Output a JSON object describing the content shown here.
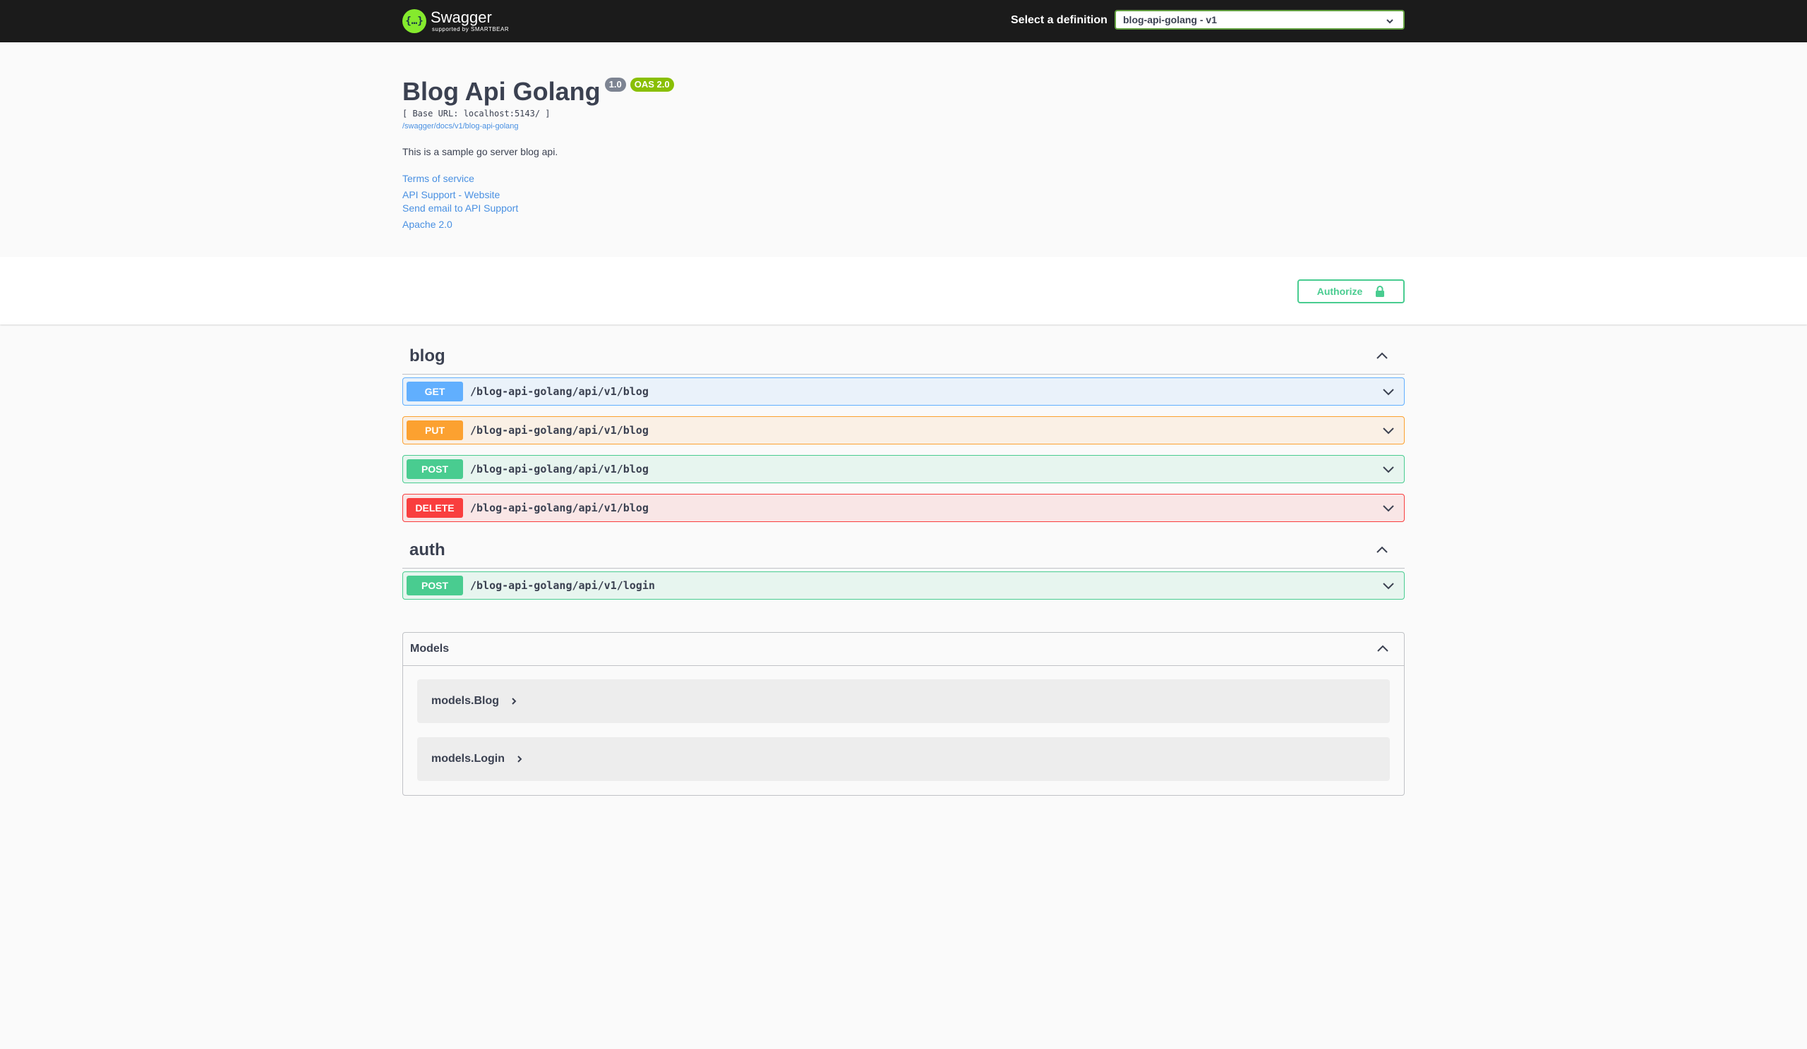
{
  "topbar": {
    "logo_name": "Swagger",
    "logo_sub": "supported by SMARTBEAR",
    "logo_icon": "swagger-braces-icon",
    "definition_label": "Select a definition",
    "definition_value": "blog-api-golang - v1"
  },
  "info": {
    "title": "Blog Api Golang",
    "version": "1.0",
    "oas": "OAS 2.0",
    "base_url": "[ Base URL: localhost:5143/ ]",
    "spec_link": "/swagger/docs/v1/blog-api-golang",
    "description": "This is a sample go server blog api.",
    "links": [
      "Terms of service",
      "API Support - Website",
      "Send email to API Support",
      "Apache 2.0"
    ]
  },
  "auth_button": {
    "label": "Authorize",
    "icon": "lock-icon"
  },
  "tags": [
    {
      "name": "blog",
      "operations": [
        {
          "method": "GET",
          "path": "/blog-api-golang/api/v1/blog"
        },
        {
          "method": "PUT",
          "path": "/blog-api-golang/api/v1/blog"
        },
        {
          "method": "POST",
          "path": "/blog-api-golang/api/v1/blog"
        },
        {
          "method": "DELETE",
          "path": "/blog-api-golang/api/v1/blog"
        }
      ]
    },
    {
      "name": "auth",
      "operations": [
        {
          "method": "POST",
          "path": "/blog-api-golang/api/v1/login"
        }
      ]
    }
  ],
  "models": {
    "title": "Models",
    "items": [
      "models.Blog",
      "models.Login"
    ]
  },
  "colors": {
    "get": "#61affe",
    "put": "#fca130",
    "post": "#49cc90",
    "delete": "#f93e3e",
    "topbar": "#1b1b1b",
    "logo": "#85ea2d"
  }
}
